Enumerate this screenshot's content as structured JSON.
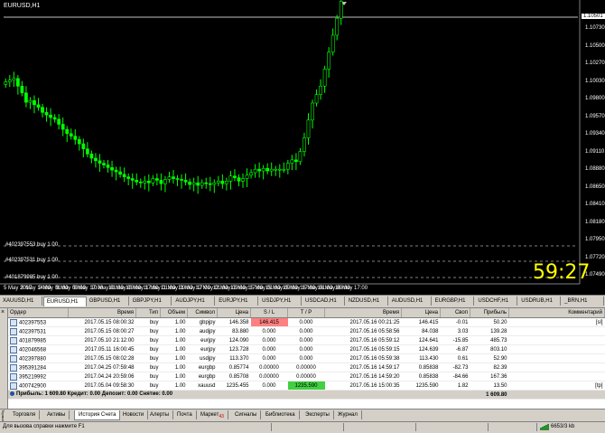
{
  "chart": {
    "title": "EURUSD,H1",
    "countdown": "59:27",
    "current_price": "1.10501",
    "price_ticks": [
      "1.10501",
      "1.10730",
      "1.10500",
      "1.10270",
      "1.10030",
      "1.09800",
      "1.09570",
      "1.09340",
      "1.09110",
      "1.08880",
      "1.08650",
      "1.08410",
      "1.08180",
      "1.07950",
      "1.07720",
      "1.07490"
    ],
    "date_ticks": [
      "5 May 2017",
      "8 May 14:00",
      "9 May 01:00",
      "9 May 09:00",
      "9 May 17:00",
      "10 May 01:00",
      "10 May 09:00",
      "10 May 17:00",
      "11 May 01:00",
      "11 May 09:00",
      "11 May 17:00",
      "12 May 01:00",
      "12 May 09:00",
      "12 May 17:00",
      "15 May 01:00",
      "15 May 09:00",
      "15 May 17:00",
      "16 May 01:00",
      "16 May 09:00",
      "16 May 17:00"
    ],
    "order_lines": [
      "#402397553 buy 1.00",
      "#402397531 buy 1.00",
      "#401879985 buy 1.00"
    ],
    "colors": {
      "background": "#000000",
      "candle": "#00ff00",
      "countdown": "#ffff00",
      "order_line": "#808080"
    }
  },
  "chart_data": {
    "type": "candlestick",
    "title": "EURUSD,H1",
    "series": [
      {
        "name": "EURUSD,H1",
        "close": [
          1.0985,
          1.0987,
          1.0989,
          1.098,
          1.0972,
          1.0961,
          1.0963,
          1.0958,
          1.0955,
          1.0949,
          1.0946,
          1.0943,
          1.0941,
          1.0935,
          1.0929,
          1.0924,
          1.0921,
          1.0917,
          1.0912,
          1.0906,
          1.09,
          1.0895,
          1.0892,
          1.0889,
          1.0887,
          1.0884,
          1.0881,
          1.0879,
          1.0876,
          1.0873,
          1.0871,
          1.0869,
          1.0867,
          1.0866,
          1.0868,
          1.0866,
          1.0871,
          1.0869,
          1.0865,
          1.087,
          1.0873,
          1.0871,
          1.087,
          1.0869,
          1.0867,
          1.0864,
          1.0866,
          1.0863,
          1.0866,
          1.0865,
          1.0864,
          1.0866,
          1.0868,
          1.0865,
          1.0868,
          1.0874,
          1.0872,
          1.0868,
          1.0871,
          1.0875,
          1.0878,
          1.0882,
          1.088,
          1.0883,
          1.088,
          1.0882,
          1.0882,
          1.0882,
          1.0882,
          1.0889,
          1.0893,
          1.0891,
          1.0903,
          1.0919,
          1.094,
          1.096,
          1.097,
          1.098,
          1.1,
          1.102,
          1.104,
          1.106,
          1.108
        ]
      }
    ],
    "ylim": [
      1.0749,
      1.1073
    ]
  },
  "symbol_tabs": [
    "XAUUSD,H1",
    "EURUSD,H1",
    "GBPUSD,H1",
    "GBPJPY,H1",
    "AUDJPY,H1",
    "EURJPY,H1",
    "USDJPY,H1",
    "USDCAD,H1",
    "NZDUSD,H1",
    "AUDUSD,H1",
    "EURGBP,H1",
    "USDCHF,H1",
    "USDRUB,H1",
    "_BRN,H1"
  ],
  "table": {
    "headers": {
      "order": "Ордер",
      "open_time": "Время",
      "type": "Тип",
      "volume": "Объем",
      "symbol": "Символ",
      "open_price": "Цена",
      "sl": "S / L",
      "tp": "T / P",
      "close_time": "Время",
      "close_price": "Цена",
      "swap": "Своп",
      "profit": "Прибыль",
      "comment": "Комментарий"
    },
    "rows": [
      {
        "order": "402397553",
        "open_time": "2017.05.15 08:00:32",
        "type": "buy",
        "volume": "1.00",
        "symbol": "gbpjpy",
        "open_price": "146.358",
        "sl": "146.415",
        "tp": "0.000",
        "close_time": "2017.05.16 00:21:25",
        "close_price": "146.415",
        "swap": "-0.01",
        "profit": "50.20",
        "comment": "[sl]"
      },
      {
        "order": "402397531",
        "open_time": "2017.05.15 08:00:27",
        "type": "buy",
        "volume": "1.00",
        "symbol": "audjpy",
        "open_price": "83.880",
        "sl": "0.000",
        "tp": "0.000",
        "close_time": "2017.05.16 05:58:56",
        "close_price": "84.038",
        "swap": "3.03",
        "profit": "139.28",
        "comment": ""
      },
      {
        "order": "401879985",
        "open_time": "2017.05.10 21:12:00",
        "type": "buy",
        "volume": "1.00",
        "symbol": "eurjpy",
        "open_price": "124.090",
        "sl": "0.000",
        "tp": "0.000",
        "close_time": "2017.05.16 05:59:12",
        "close_price": "124.641",
        "swap": "-15.85",
        "profit": "485.73",
        "comment": ""
      },
      {
        "order": "402046568",
        "open_time": "2017.05.11 16:00:45",
        "type": "buy",
        "volume": "1.00",
        "symbol": "eurjpy",
        "open_price": "123.728",
        "sl": "0.000",
        "tp": "0.000",
        "close_time": "2017.05.16 05:59:15",
        "close_price": "124.639",
        "swap": "-6.87",
        "profit": "803.10",
        "comment": ""
      },
      {
        "order": "402397880",
        "open_time": "2017.05.15 08:02:28",
        "type": "buy",
        "volume": "1.00",
        "symbol": "usdjpy",
        "open_price": "113.370",
        "sl": "0.000",
        "tp": "0.000",
        "close_time": "2017.05.16 05:59:38",
        "close_price": "113.430",
        "swap": "0.61",
        "profit": "52.90",
        "comment": ""
      },
      {
        "order": "395391284",
        "open_time": "2017.04.25 07:59:48",
        "type": "buy",
        "volume": "1.00",
        "symbol": "eurgbp",
        "open_price": "0.85774",
        "sl": "0.00000",
        "tp": "0.00000",
        "close_time": "2017.05.16 14:59:17",
        "close_price": "0.85838",
        "swap": "-82.73",
        "profit": "82.39",
        "comment": ""
      },
      {
        "order": "395219992",
        "open_time": "2017.04.24 20:59:06",
        "type": "buy",
        "volume": "1.00",
        "symbol": "eurgbp",
        "open_price": "0.85708",
        "sl": "0.00000",
        "tp": "0.00000",
        "close_time": "2017.05.16 14:59:20",
        "close_price": "0.85838",
        "swap": "-84.66",
        "profit": "167.36",
        "comment": ""
      },
      {
        "order": "400742900",
        "open_time": "2017.05.04 09:58:30",
        "type": "buy",
        "volume": "1.00",
        "symbol": "xauusd",
        "open_price": "1235.455",
        "sl": "0.000",
        "tp": "1235.590",
        "close_time": "2017.05.16 15:00:35",
        "close_price": "1235.590",
        "swap": "1.82",
        "profit": "13.50",
        "comment": "[tp]"
      }
    ],
    "summary": {
      "text": "Прибыль: 1 609.80 Кредит: 0.00 Депозит: 0.00 Снятие: 0.00",
      "total": "1 609.80"
    },
    "highlight": {
      "sl_row": 0,
      "tp_row": 7
    }
  },
  "bottom_tabs": {
    "side_label": "Терминал",
    "tabs": [
      {
        "label": "Торговля"
      },
      {
        "label": "Активы"
      },
      {
        "label": "История Счета"
      },
      {
        "label": "Новости"
      },
      {
        "label": "Алерты"
      },
      {
        "label": "Почта"
      },
      {
        "label": "Маркет",
        "badge": "43"
      },
      {
        "label": "Сигналы"
      },
      {
        "label": "Библиотека"
      },
      {
        "label": "Эксперты"
      },
      {
        "label": "Журнал"
      }
    ]
  },
  "status": {
    "help_text": "Для вызова справки нажмите F1",
    "connection": "6653/3 kb"
  }
}
